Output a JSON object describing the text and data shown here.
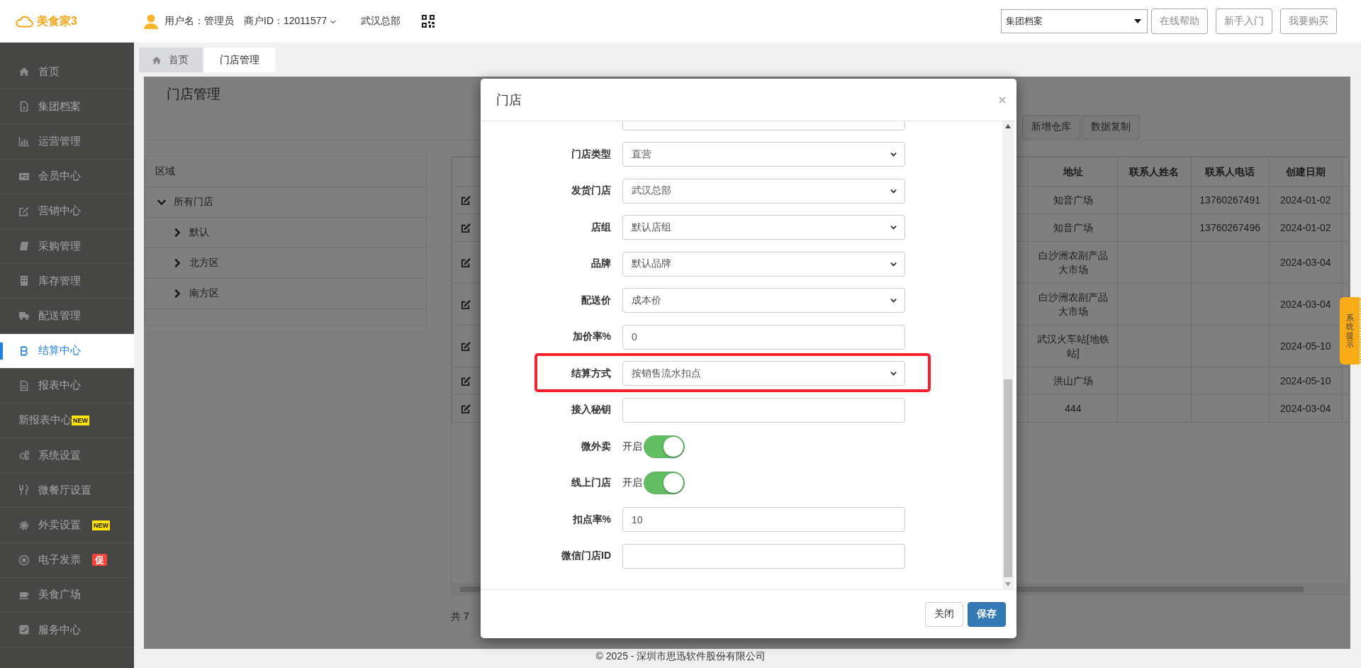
{
  "header": {
    "logo": "美食家3",
    "user": "用户名：管理员",
    "merchant": "商户ID：12011577",
    "store": "武汉总部",
    "group_select": "集团档案",
    "buttons": [
      "在线帮助",
      "新手入门",
      "我要购买"
    ]
  },
  "sidebar": {
    "items": [
      {
        "label": "首页",
        "selected": false
      },
      {
        "label": "集团档案",
        "selected": false
      },
      {
        "label": "运营管理",
        "selected": false
      },
      {
        "label": "会员中心",
        "selected": false
      },
      {
        "label": "营销中心",
        "selected": false
      },
      {
        "label": "采购管理",
        "selected": false
      },
      {
        "label": "库存管理",
        "selected": false
      },
      {
        "label": "配送管理",
        "selected": false
      },
      {
        "label": "结算中心",
        "selected": true
      },
      {
        "label": "报表中心",
        "selected": false
      },
      {
        "label": "新报表中心",
        "selected": false,
        "badge": {
          "text": "NEW",
          "kind": "new"
        }
      },
      {
        "label": "系统设置",
        "selected": false
      },
      {
        "label": "微餐厅设置",
        "selected": false
      },
      {
        "label": "外卖设置",
        "selected": false,
        "badge": {
          "text": "NEW",
          "kind": "new"
        }
      },
      {
        "label": "电子发票",
        "selected": false,
        "badge": {
          "text": "促",
          "kind": "promo"
        }
      },
      {
        "label": "美食广场",
        "selected": false
      },
      {
        "label": "服务中心",
        "selected": false
      }
    ]
  },
  "tabs": [
    {
      "label": "首页",
      "selected": false
    },
    {
      "label": "门店管理",
      "selected": true
    }
  ],
  "page": {
    "title": "门店管理",
    "toolbar": [
      "新增仓库",
      "数据复制"
    ],
    "region_panel": {
      "title": "区域",
      "tree": [
        {
          "label": "所有门店",
          "expanded": true,
          "children": [
            {
              "label": "默认",
              "expanded": false
            },
            {
              "label": "北方区",
              "expanded": false
            },
            {
              "label": "南方区",
              "expanded": false
            }
          ]
        }
      ]
    },
    "table": {
      "columns": [
        "地址",
        "联系人姓名",
        "联系人电话",
        "创建日期"
      ],
      "rows": [
        {
          "address": "知音广场",
          "contact_phone": "13760267491",
          "created_date": "2024-01-02"
        },
        {
          "address": "知音广场",
          "contact_phone": "13760267496",
          "created_date": "2024-01-02"
        },
        {
          "address": "白沙洲农副产品大市场",
          "created_date": "2024-03-04"
        },
        {
          "address": "白沙洲农副产品大市场",
          "created_date": "2024-03-04"
        },
        {
          "address": "武汉火车站[地铁站]",
          "created_date": "2024-05-10"
        },
        {
          "address": "洪山广场",
          "created_date": "2024-05-10"
        },
        {
          "address": "444",
          "created_date": "2024-03-04"
        }
      ]
    },
    "pager": "共 7"
  },
  "modal": {
    "title": "门店",
    "fields": [
      {
        "kind": "text",
        "highlighted": false
      },
      {
        "label": "门店类型",
        "kind": "select",
        "value": "直营",
        "highlighted": false
      },
      {
        "label": "发货门店",
        "kind": "select",
        "value": "武汉总部",
        "highlighted": false
      },
      {
        "label": "店组",
        "kind": "select",
        "value": "默认店组",
        "highlighted": false
      },
      {
        "label": "品牌",
        "kind": "select",
        "value": "默认品牌",
        "highlighted": false
      },
      {
        "label": "配送价",
        "kind": "select",
        "value": "成本价",
        "highlighted": false
      },
      {
        "label": "加价率%",
        "kind": "text",
        "value": "0",
        "highlighted": false
      },
      {
        "label": "结算方式",
        "kind": "select",
        "value": "按销售流水扣点",
        "highlighted": true
      },
      {
        "label": "接入秘钥",
        "kind": "text",
        "highlighted": false
      },
      {
        "label": "微外卖",
        "kind": "switch",
        "on": true,
        "state_label": "开启",
        "highlighted": false
      },
      {
        "label": "线上门店",
        "kind": "switch",
        "on": true,
        "state_label": "开启",
        "highlighted": false
      },
      {
        "label": "扣点率%",
        "kind": "text",
        "value": "10",
        "highlighted": false
      },
      {
        "label": "微信门店ID",
        "kind": "text",
        "highlighted": false
      }
    ],
    "buttons": [
      {
        "label": "关闭",
        "kind": "default"
      },
      {
        "label": "保存",
        "kind": "primary"
      }
    ]
  },
  "side_tip": "系统提示",
  "footer": "© 2025 - 深圳市思迅软件股份有限公司"
}
